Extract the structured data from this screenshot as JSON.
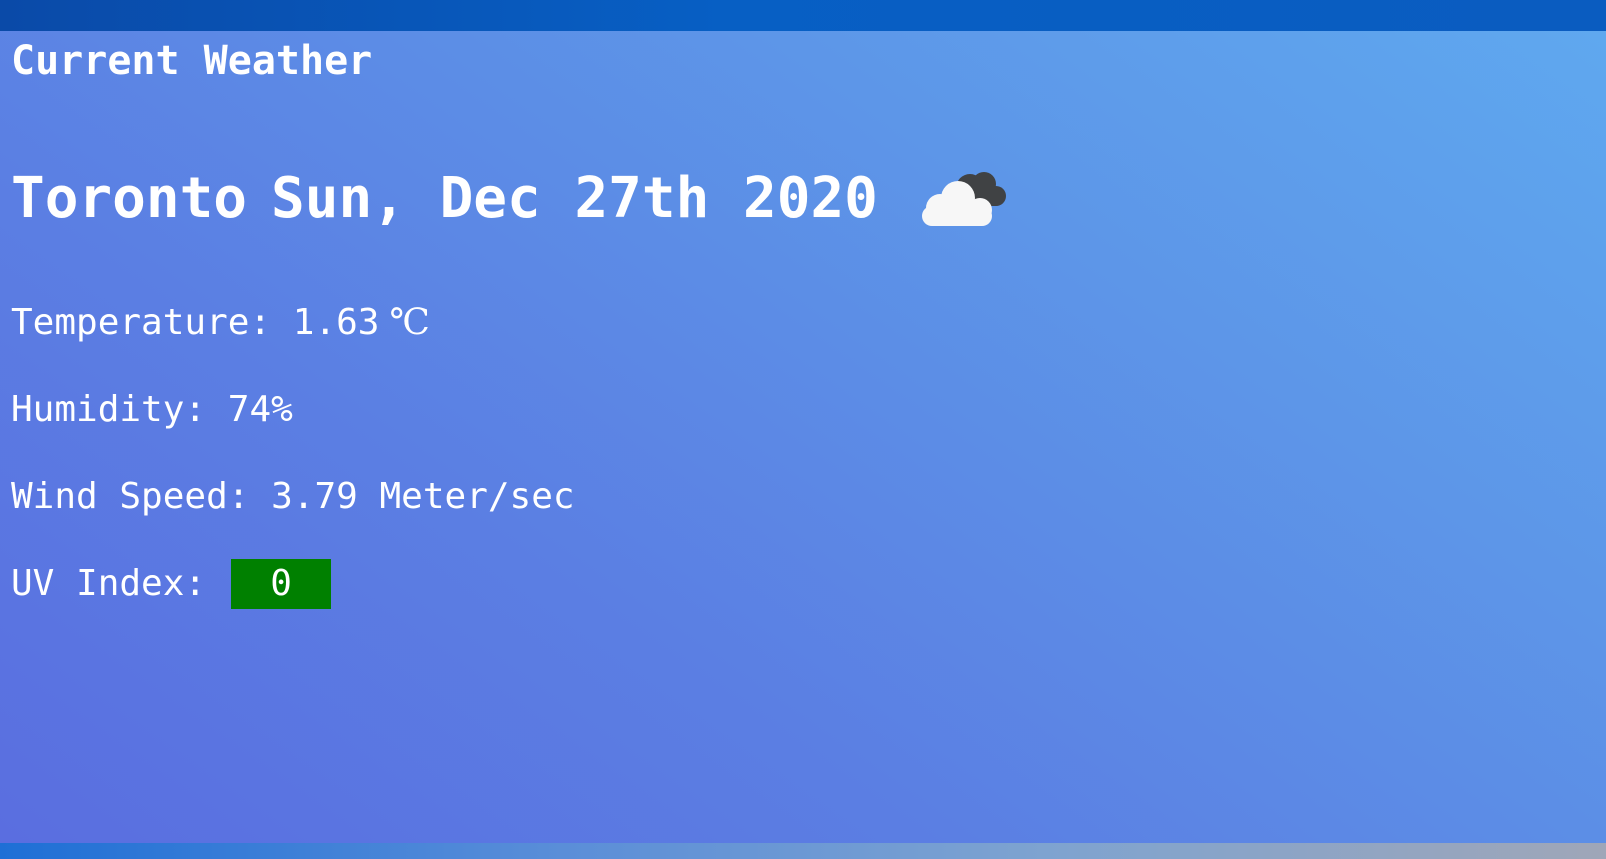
{
  "app": {
    "heading": "Current Weather"
  },
  "location": {
    "city": "Toronto",
    "date": "Sun, Dec 27th 2020",
    "condition_icon": "cloudy-icon"
  },
  "stats": {
    "temperature": {
      "label": "Temperature:",
      "value": "1.63",
      "unit": "℃"
    },
    "humidity": {
      "label": "Humidity:",
      "value": "74%"
    },
    "wind_speed": {
      "label": "Wind Speed:",
      "value": "3.79",
      "unit": "Meter/sec"
    },
    "uv_index": {
      "label": "UV Index:",
      "value": "0",
      "badge_color": "#008000"
    }
  },
  "colors": {
    "background_gradient": [
      "#5a6ee0",
      "#5fa8ef"
    ],
    "text": "#ffffff",
    "uv_badge": "#008000"
  }
}
